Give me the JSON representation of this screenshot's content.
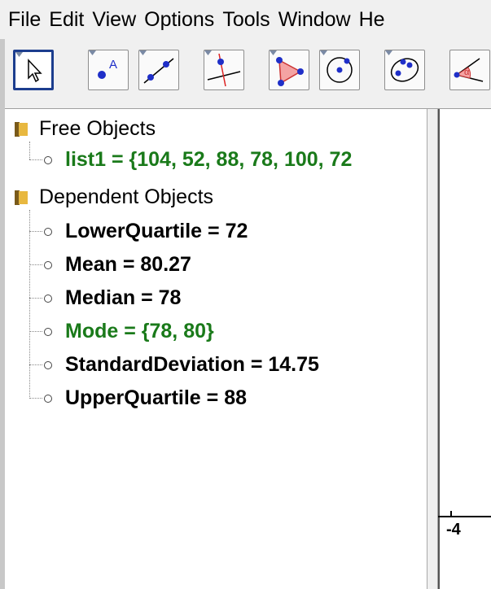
{
  "menu": [
    "File",
    "Edit",
    "View",
    "Options",
    "Tools",
    "Window",
    "He"
  ],
  "toolbar": {
    "tools": [
      {
        "name": "move-tool"
      },
      {
        "name": "point-tool",
        "label": "A"
      },
      {
        "name": "line-tool"
      },
      {
        "name": "perpendicular-line-tool"
      },
      {
        "name": "polygon-tool"
      },
      {
        "name": "circle-tool"
      },
      {
        "name": "conic-tool"
      },
      {
        "name": "angle-tool",
        "label": "α"
      }
    ]
  },
  "algebra": {
    "free_header": "Free Objects",
    "free_items": [
      {
        "text": "list1 = {104, 52, 88, 78, 100, 72",
        "color": "#1a7a1a"
      }
    ],
    "dependent_header": "Dependent Objects",
    "dependent_items": [
      {
        "text": "LowerQuartile = 72",
        "color": "#000000"
      },
      {
        "text": "Mean = 80.27",
        "color": "#000000"
      },
      {
        "text": "Median = 78",
        "color": "#000000"
      },
      {
        "text": "Mode = {78, 80}",
        "color": "#1a7a1a"
      },
      {
        "text": "StandardDeviation = 14.75",
        "color": "#000000"
      },
      {
        "text": "UpperQuartile = 88",
        "color": "#000000"
      }
    ]
  },
  "graphics": {
    "x_tick_label": "-4"
  }
}
